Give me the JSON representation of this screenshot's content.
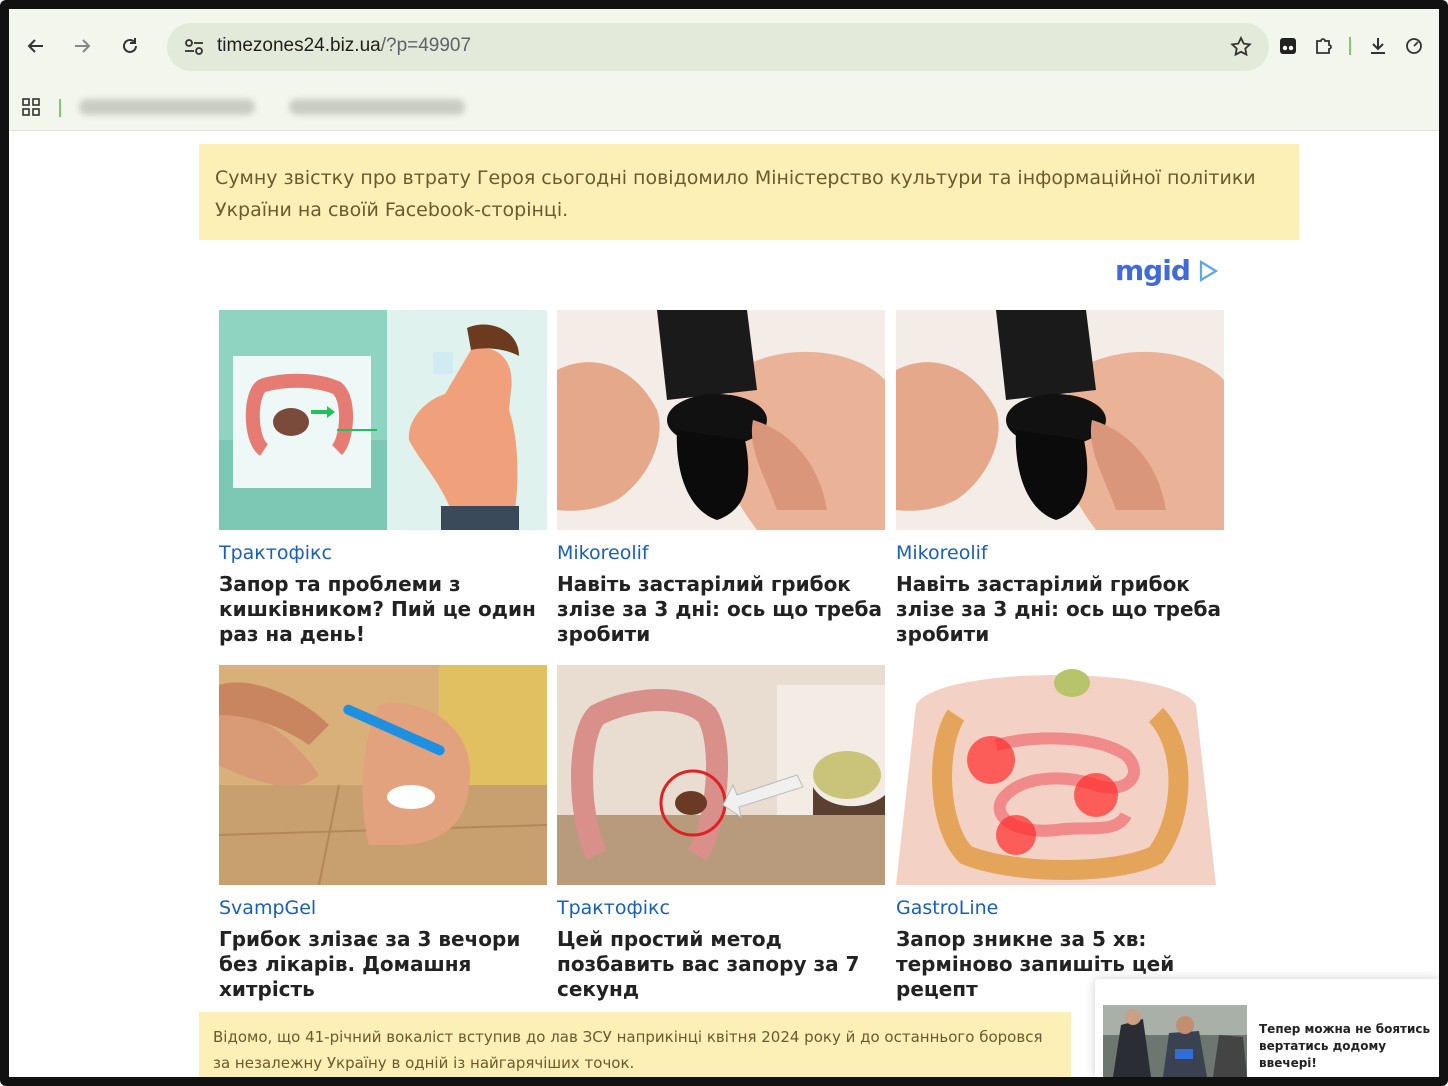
{
  "browser": {
    "url_host": "timezones24.biz.ua",
    "url_path": "/?p=49907",
    "bookmarks": [
      "",
      ""
    ]
  },
  "article": {
    "paragraph_top": "Сумну звістку про втрату Героя сьогодні повідомило Міністерство культури та інформаційної політики України на своїй Facebook-сторінці.",
    "paragraph_bottom": "Відомо, що 41-річний вокаліст вступив до лав ЗСУ наприкінці квітня 2024 року й до останнього боровся за незалежну Україну в одній із найгарячіших точок."
  },
  "ad_widget": {
    "brand": "mgid",
    "cards": [
      {
        "source": "Трактофікс",
        "title": "Запор та проблеми з кишківником? Пий це один раз на день!",
        "image": "intestine-and-man-drinking-illustration"
      },
      {
        "source": "Mikoreolif",
        "title": "Навіть застарілий грибок злізе за 3 дні: ось що треба зробити",
        "image": "black-liquid-bottle-on-finger-photo"
      },
      {
        "source": "Mikoreolif",
        "title": "Навіть застарілий грибок злізе за 3 дні: ось що треба зробити",
        "image": "black-liquid-bottle-on-finger-photo"
      },
      {
        "source": "SvampGel",
        "title": "Грибок злізає за 3 вечори без лікарів. Домашня хитрість",
        "image": "toothbrush-on-toenail-photo"
      },
      {
        "source": "Трактофікс",
        "title": "Цей простий метод позбавить вас запору за 7 секунд",
        "image": "colon-with-powder-spoon-illustration"
      },
      {
        "source": "GastroLine",
        "title": "Запор зникне за 5 хв: терміново запишіть цей рецепт",
        "image": "inflamed-intestines-illustration"
      }
    ]
  },
  "toast": {
    "text": "Тепер можна не боятись вертатись додому ввечері!"
  },
  "colors": {
    "quote_bg": "#fdf0b6",
    "source_link": "#1a5fb4",
    "browser_bg": "#f2f6ec"
  }
}
